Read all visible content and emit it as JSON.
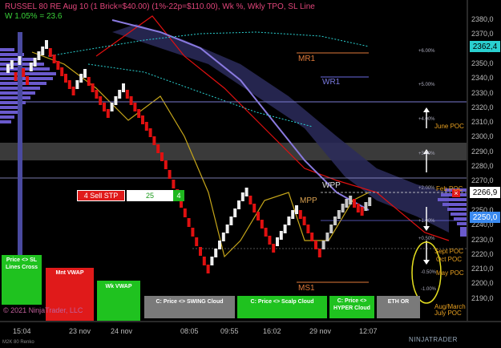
{
  "title": "RUSSEL 80 RE Aug 10 (1 Brick=$40.00) (1%-22p=$110.00), Wk %, Wkly TPO, SL Line",
  "subtitle": "W 1.05% = 23.6",
  "levels": {
    "mr1": "MR1",
    "wr1": "WR1",
    "wpp": "WPP",
    "mpp": "MPP",
    "ms1": "MS1"
  },
  "order": {
    "sell_stp": "4 Sell STP",
    "quantity": "25",
    "count": "4",
    "close": "×"
  },
  "price_axis": [
    "2380,0",
    "2370,0",
    "2360,0",
    "2350,0",
    "2340,0",
    "2330,0",
    "2320,0",
    "2310,0",
    "2300,0",
    "2290,0",
    "2280,0",
    "2270,0",
    "2260,0",
    "2250,0",
    "2240,0",
    "2230,0",
    "2220,0",
    "2210,0",
    "2200,0",
    "2190,0"
  ],
  "price_tags": {
    "top": "2362,4",
    "mid": "2266,9",
    "low": "2250,0"
  },
  "percent_labels": {
    "p6": "+6.00%",
    "p5": "+5.00%",
    "p4": "+4.00%",
    "p3": "+3.00%",
    "p2": "+2.00%",
    "p1": "+1.00%",
    "p05": "+0.50%",
    "m05": "-0.50%",
    "m1": "-1.00%"
  },
  "poc_labels": {
    "june": "June POC",
    "feb": "Feb POC",
    "sept": "Sept POC",
    "oct": "Oct POC",
    "may": "May POC",
    "augmarch": "Aug/March",
    "july": "July POC"
  },
  "buttons": {
    "price_sl": "Price <> SL Lines Cross",
    "mnt_vwap": "Mnt VWAP",
    "wk_vwap": "Wk VWAP",
    "swing": "C: Price <> SWING Cloud",
    "scalp": "C: Price <> Scalp Cloud",
    "hyper": "C: Price <> HYPER Cloud",
    "eth": "ETH OR"
  },
  "x_axis": [
    "15:04",
    "23 nov",
    "24 nov",
    "08:05",
    "09:55",
    "16:02",
    "29 nov",
    "12:07"
  ],
  "copyright": "© 2021 NinjaTrader, LLC",
  "footer": "M2K 80 Renko",
  "logo": "NINJATRADER",
  "colors": {
    "up": "#f0f0f0",
    "down": "#e01010",
    "background": "#000000",
    "cloud": "#3a3a6a"
  }
}
